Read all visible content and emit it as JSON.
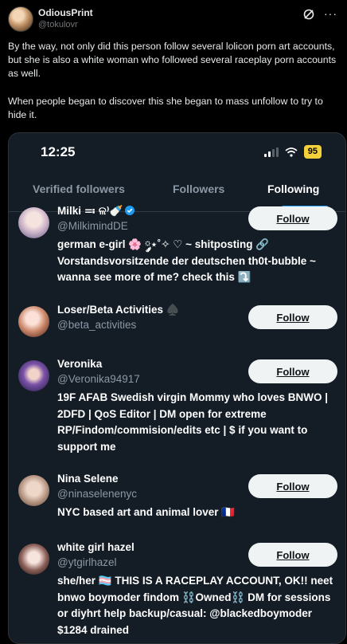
{
  "post": {
    "display_name": "OdiousPrint",
    "handle": "@tokulovr",
    "more_label": "···",
    "text": "By the way, not only did this person follow several lolicon porn art accounts, but she is also a white woman who followed several raceplay porn accounts as well.\n\nWhen people began to discover this she began to mass unfollow to try to hide it."
  },
  "phone": {
    "time": "12:25",
    "battery": "95",
    "tabs": [
      {
        "label": "Verified followers"
      },
      {
        "label": "Followers"
      },
      {
        "label": "Following"
      }
    ],
    "users": [
      {
        "name": "Milki ≕ ଳ⁾🍼",
        "handle": "@MilkimindDE",
        "button": "Follow",
        "bio": "german e-girl 🌸 ༘⋆˚✧ ♡ ~ shitposting 🔗 Vorstandsvorsitzende der deutschen th0t-bubble ~ wanna see more of me? check this ⤵️"
      },
      {
        "name": "Loser/Beta Activities ♠️",
        "handle": "@beta_activities",
        "button": "Follow",
        "bio": ""
      },
      {
        "name": "Veronika",
        "handle": "@Veronika94917",
        "button": "Follow",
        "bio": "19F AFAB Swedish virgin Mommy who loves BNWO | 2DFD | QoS Editor | DM open for extreme RP/Findom/commision/edits etc | $ if you want to support me"
      },
      {
        "name": "Nina Selene",
        "handle": "@ninaselenenyc",
        "button": "Follow",
        "bio": "NYC based art and animal lover 🇫🇷"
      },
      {
        "name": "white girl hazel",
        "handle": "@ytgirlhazel",
        "button": "Follow",
        "bio": "she/her 🏳️‍⚧️ THIS IS A RACEPLAY ACCOUNT, OK!! neet bnwo boymoder findom ⛓️Owned⛓️ DM for sessions or diyhrt help backup/casual: @blackedboymoder $1284 drained"
      }
    ]
  },
  "colors": {
    "accent": "#1d9bf0",
    "battery": "#f4d13a",
    "phone_bg": "#141d26"
  }
}
